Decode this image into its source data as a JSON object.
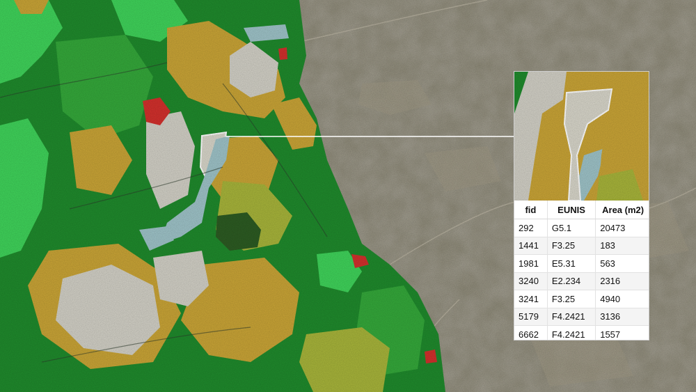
{
  "map": {
    "layers": {
      "basemap": "satellite-hillshade",
      "habitat": "EUNIS habitat polygons"
    },
    "colors": {
      "forest_dark": "#1f8a2c",
      "forest_mid": "#34a83a",
      "grassland_bright": "#3fd35a",
      "heath_ochre": "#c9a436",
      "bare_grey": "#d2d0c6",
      "water_blue": "#9ec3c8",
      "urban_red": "#d2302c",
      "olive": "#a7b43a",
      "deep_forest": "#2c5b22",
      "highlight_outline": "#ffffff"
    }
  },
  "table": {
    "columns": [
      "fid",
      "EUNIS",
      "Area (m2)"
    ],
    "rows": [
      {
        "fid": "292",
        "eunis": "G5.1",
        "area": "20473"
      },
      {
        "fid": "1441",
        "eunis": "F3.25",
        "area": "183"
      },
      {
        "fid": "1981",
        "eunis": "E5.31",
        "area": "563"
      },
      {
        "fid": "3240",
        "eunis": "E2.234",
        "area": "2316"
      },
      {
        "fid": "3241",
        "eunis": "F3.25",
        "area": "4940"
      },
      {
        "fid": "5179",
        "eunis": "F4.2421",
        "area": "3136"
      },
      {
        "fid": "6662",
        "eunis": "F4.2421",
        "area": "1557"
      }
    ]
  }
}
